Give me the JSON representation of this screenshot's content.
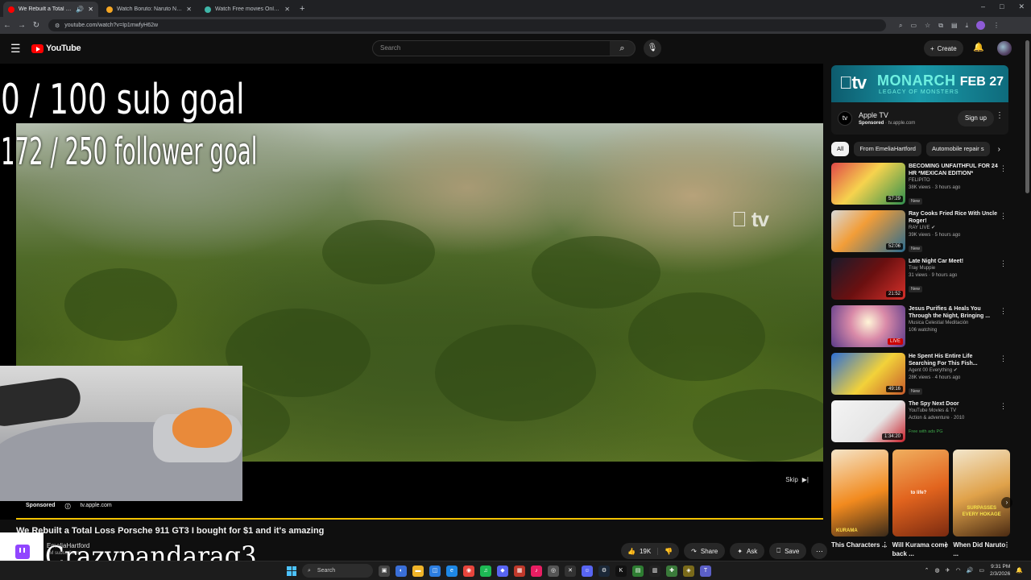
{
  "browser": {
    "tabs": [
      {
        "title": "We Rebuilt a Total Loss Porsche 911 GT3 I bought for $1",
        "active": true,
        "favicon_color": "#ff0000"
      },
      {
        "title": "Watch Boruto: Naruto Next Generations",
        "active": false,
        "favicon_color": "#f5a623"
      },
      {
        "title": "Watch Free movies Online | 123",
        "active": false,
        "favicon_color": "#3fb6a8"
      }
    ],
    "new_tab": "+",
    "url": "youtube.com/watch?v=Ip1mwfyH62w",
    "window_controls": [
      "–",
      "□",
      "✕"
    ]
  },
  "yt": {
    "logo_text": "YouTube",
    "search_placeholder": "Search",
    "create_label": "Create",
    "accent": "#ff0000"
  },
  "player": {
    "overlay_sub_goal": "0 / 100 sub goal",
    "overlay_follower_goal": "172 / 250 follower goal",
    "watermark": " tv",
    "skip_label": "Skip",
    "sponsored_label": "Sponsored",
    "ad_url": "tv.apple.com",
    "progress_color": "#f2c200"
  },
  "video": {
    "title": "We Rebuilt a Total Loss Porsche 911 GT3 I bought for $1 and it's amazing",
    "channel": "EmeliaHartford",
    "channel_subs": "1M subscribers",
    "stream_overlay_name": "Crazypandarag3",
    "likes": "19K",
    "share_label": "Share",
    "ask_label": "Ask",
    "save_label": "Save"
  },
  "sidebar": {
    "ad": {
      "banner_brand": "tv",
      "banner_show": "MONARCH",
      "banner_tagline": "LEGACY OF MONSTERS",
      "banner_date": "FEB 27",
      "name": "Apple TV",
      "sponsored": "Sponsored",
      "domain": "tv.apple.com",
      "cta": "Sign up"
    },
    "chips": [
      "All",
      "From EmeliaHartford",
      "Automobile repair s"
    ],
    "videos": [
      {
        "title": "BECOMING UNFAITHFUL FOR 24 HR *MEXICAN EDITION*",
        "channel": "FELIPITO",
        "stats": "38K views · 3 hours ago",
        "badge": "New",
        "duration": "57:29",
        "live": false
      },
      {
        "title": "Ray Cooks Fried Rice With Uncle Roger!",
        "channel": "RAY LIVE ✔",
        "stats": "39K views · 5 hours ago",
        "badge": "New",
        "duration": "52:06",
        "live": false
      },
      {
        "title": "Late Night Car Meet!",
        "channel": "Tray Muppie",
        "stats": "31 views · 9 hours ago",
        "badge": "New",
        "duration": "21:52",
        "live": false
      },
      {
        "title": "Jesus Purifies & Heals You Through the Night, Bringing ...",
        "channel": "Musica Celestial Meditación",
        "stats": "106 watching",
        "badge": "",
        "duration": "LIVE",
        "live": true
      },
      {
        "title": "He Spent His Entire Life Searching For This Fish...",
        "channel": "Agent 00 Everything ✔",
        "stats": "28K views · 4 hours ago",
        "badge": "New",
        "duration": "49:16",
        "live": false
      },
      {
        "title": "The Spy Next Door",
        "channel": "YouTube Movies & TV",
        "stats": "Action & adventure · 2010",
        "badge": "Free with ads  PG",
        "duration": "1:34:20",
        "live": false
      }
    ],
    "shorts": [
      {
        "title": "This Characters ..."
      },
      {
        "title": "Will Kurama come back ..."
      },
      {
        "title": "When Did Naruto ..."
      }
    ],
    "short_texts": [
      "KURAMA",
      "to life?",
      "SURPASSES EVERY HOKAGE"
    ]
  },
  "taskbar": {
    "search_label": "Search",
    "time": "9:31 PM",
    "date": "2/3/2026"
  }
}
